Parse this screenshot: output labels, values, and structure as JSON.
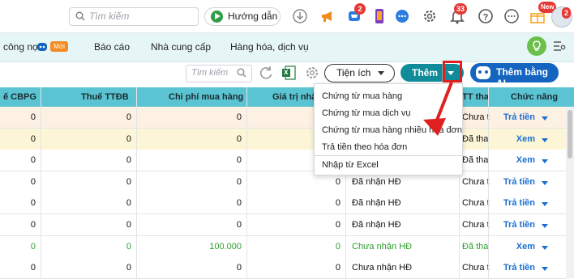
{
  "topbar": {
    "search_placeholder": "Tìm kiếm",
    "guide_label": "Hướng dẫn",
    "cart_badge": "2",
    "notif_badge": "33",
    "new_label": "New",
    "avatar_badge": "2"
  },
  "nav": {
    "tabs": [
      "công nợ",
      "Báo cáo",
      "Nhà cung cấp",
      "Hàng hóa, dịch vụ"
    ],
    "new_pill": "Mới"
  },
  "toolbar": {
    "search_placeholder": "Tìm kiếm",
    "excel_label": "x",
    "utility_label": "Tiện ích",
    "add_label": "Thêm",
    "ai_label": "Thêm bằng AI"
  },
  "table": {
    "headers": [
      "ế CBPG",
      "Thuế TTĐB",
      "Chi phí mua hàng",
      "Giá trị nhập",
      "",
      "TT tha",
      "Chức năng"
    ],
    "rows": [
      {
        "c1": "0",
        "c2": "0",
        "c3": "0",
        "c4": "",
        "c5": "",
        "c6": "Chưa t",
        "act": "Trả tiền",
        "tone": "peach"
      },
      {
        "c1": "0",
        "c2": "0",
        "c3": "0",
        "c4": "",
        "c5": "",
        "c6": "Đã tha",
        "act": "Xem",
        "tone": "yellow"
      },
      {
        "c1": "0",
        "c2": "0",
        "c3": "0",
        "c4": "",
        "c5": "",
        "c6": "Đã tha",
        "act": "Xem",
        "tone": "white"
      },
      {
        "c1": "0",
        "c2": "0",
        "c3": "0",
        "c4": "0",
        "c5": "Đã nhận HĐ",
        "c6": "Chưa t",
        "act": "Trả tiền",
        "tone": "white"
      },
      {
        "c1": "0",
        "c2": "0",
        "c3": "0",
        "c4": "0",
        "c5": "Đã nhận HĐ",
        "c6": "Chưa t",
        "act": "Trả tiền",
        "tone": "white"
      },
      {
        "c1": "0",
        "c2": "0",
        "c3": "0",
        "c4": "0",
        "c5": "Đã nhận HĐ",
        "c6": "Chưa t",
        "act": "Trả tiền",
        "tone": "white"
      },
      {
        "c1": "0",
        "c2": "0",
        "c3": "100.000",
        "c4": "0",
        "c5": "Chưa nhận HĐ",
        "c6": "Đã tha",
        "act": "Xem",
        "tone": "green"
      },
      {
        "c1": "0",
        "c2": "0",
        "c3": "0",
        "c4": "0",
        "c5": "Chưa nhận HĐ",
        "c6": "Chưa t",
        "act": "Trả tiền",
        "tone": "white"
      }
    ]
  },
  "menu": {
    "items": [
      "Chứng từ mua hàng",
      "Chứng từ mua dịch vụ",
      "Chứng từ mua hàng nhiều hóa đơn",
      "Trả tiền theo hóa đơn",
      "Nhập từ Excel"
    ]
  },
  "colors": {
    "accent": "#0f8b9a",
    "header": "#5bc4d3",
    "highlight": "#e02020",
    "ai": "#1565c0",
    "link": "#1a6fd1",
    "green_text": "#2e9e2e"
  }
}
